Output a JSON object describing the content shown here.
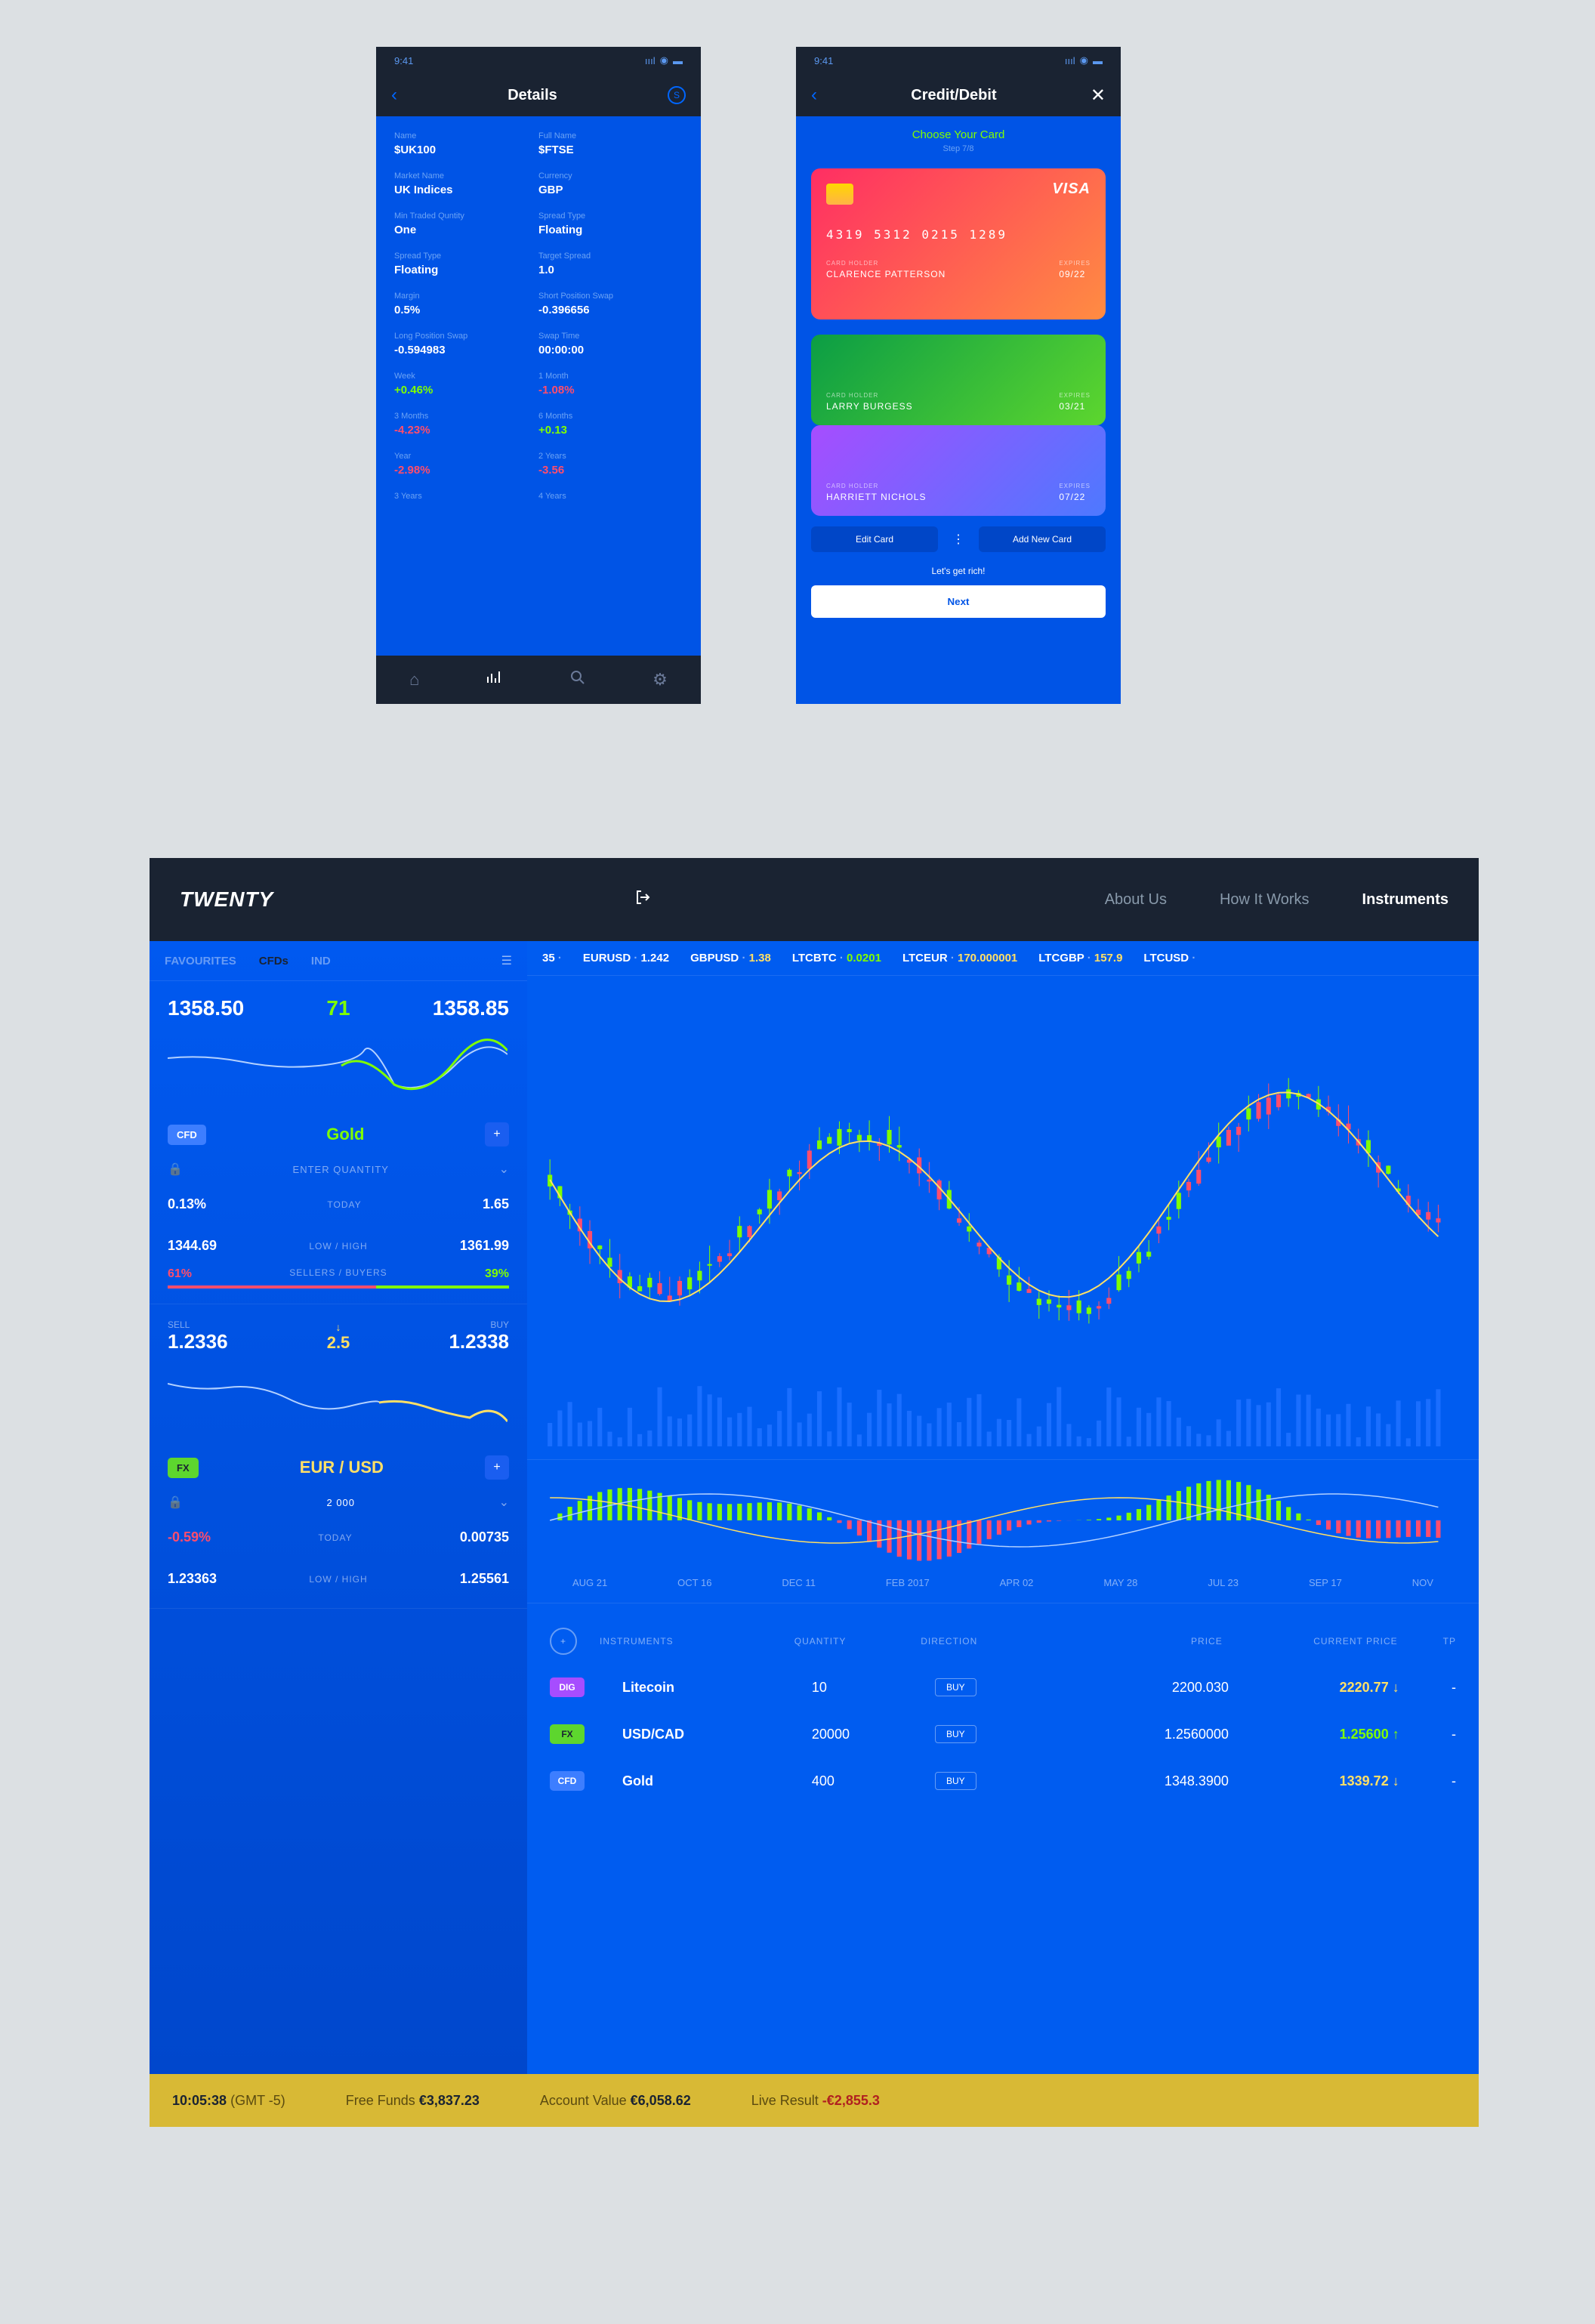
{
  "phone1": {
    "time": "9:41",
    "title": "Details",
    "fields": [
      {
        "l1": "Name",
        "v1": "$UK100",
        "l2": "Full Name",
        "v2": "$FTSE"
      },
      {
        "l1": "Market Name",
        "v1": "UK Indices",
        "l2": "Currency",
        "v2": "GBP"
      },
      {
        "l1": "Min Traded Quntity",
        "v1": "One",
        "l2": "Spread Type",
        "v2": "Floating"
      },
      {
        "l1": "Spread Type",
        "v1": "Floating",
        "l2": "Target Spread",
        "v2": "1.0"
      },
      {
        "l1": "Margin",
        "v1": "0.5%",
        "l2": "Short Position Swap",
        "v2": "-0.396656"
      },
      {
        "l1": "Long Position Swap",
        "v1": "-0.594983",
        "l2": "Swap Time",
        "v2": "00:00:00"
      }
    ],
    "perf": [
      {
        "l1": "Week",
        "v1": "+0.46%",
        "c1": "green",
        "l2": "1 Month",
        "v2": "-1.08%",
        "c2": "red"
      },
      {
        "l1": "3 Months",
        "v1": "-4.23%",
        "c1": "red",
        "l2": "6 Months",
        "v2": "+0.13",
        "c2": "green"
      },
      {
        "l1": "Year",
        "v1": "-2.98%",
        "c1": "red",
        "l2": "2 Years",
        "v2": "-3.56",
        "c2": "red"
      },
      {
        "l1": "3 Years",
        "v1": "",
        "c1": "red",
        "l2": "4 Years",
        "v2": "",
        "c2": "red"
      }
    ]
  },
  "phone2": {
    "time": "9:41",
    "title": "Credit/Debit",
    "choose": "Choose Your Card",
    "step": "Step 7/8",
    "cards": [
      {
        "brand": "VISA",
        "number": "4319   5312   0215   1289",
        "holder_label": "CARD HOLDER",
        "holder": "CLARENCE PATTERSON",
        "exp_label": "EXPIRES",
        "exp": "09/22"
      },
      {
        "holder_label": "CARD HOLDER",
        "holder": "LARRY BURGESS",
        "exp_label": "EXPIRES",
        "exp": "03/21"
      },
      {
        "holder_label": "CARD HOLDER",
        "holder": "HARRIETT NICHOLS",
        "exp_label": "EXPIRES",
        "exp": "07/22"
      }
    ],
    "edit": "Edit Card",
    "add": "Add New Card",
    "rich": "Let's get rich!",
    "next": "Next"
  },
  "app": {
    "logo": "TWENTY",
    "nav": {
      "about": "About Us",
      "how": "How It Works",
      "instruments": "Instruments"
    },
    "side_tabs": {
      "fav": "FAVOURITES",
      "cfds": "CFDs",
      "ind": "IND"
    },
    "gold": {
      "sell": "1358.50",
      "spread": "71",
      "buy": "1358.85",
      "tag": "CFD",
      "name": "Gold",
      "qty_ph": "ENTER QUANTITY",
      "change": "0.13%",
      "today": "TODAY",
      "pts": "1.65",
      "low": "1344.69",
      "lowhigh": "LOW / HIGH",
      "high": "1361.99",
      "sellers": "61%",
      "sb_label": "SELLERS / BUYERS",
      "buyers": "39%"
    },
    "eurusd": {
      "sell_label": "SELL",
      "sell": "1.2336",
      "spread": "2.5",
      "buy_label": "BUY",
      "buy": "1.2338",
      "tag": "FX",
      "name": "EUR / USD",
      "qty": "2 000",
      "change": "-0.59%",
      "today": "TODAY",
      "pts": "0.00735",
      "low": "1.23363",
      "lowhigh": "LOW / HIGH",
      "high": "1.25561"
    },
    "ticker": [
      {
        "sym": "35",
        "val": "",
        "cls": "green"
      },
      {
        "sym": "EURUSD",
        "val": "1.242",
        "cls": "white"
      },
      {
        "sym": "GBPUSD",
        "val": "1.38",
        "cls": "yellow"
      },
      {
        "sym": "LTCBTC",
        "val": "0.0201",
        "cls": "green"
      },
      {
        "sym": "LTCEUR",
        "val": "170.000001",
        "cls": "yellow"
      },
      {
        "sym": "LTCGBP",
        "val": "157.9",
        "cls": "yellow"
      },
      {
        "sym": "LTCUSD",
        "val": "",
        "cls": "white"
      }
    ],
    "dates": [
      "AUG 21",
      "OCT 16",
      "DEC 11",
      "FEB 2017",
      "APR 02",
      "MAY 28",
      "JUL 23",
      "SEP 17",
      "NOV"
    ],
    "table": {
      "headers": {
        "instr": "INSTRUMENTS",
        "qty": "QUANTITY",
        "dir": "DIRECTION",
        "price": "PRICE",
        "cprice": "CURRENT PRICE",
        "tp": "TP"
      },
      "rows": [
        {
          "tag": "DIG",
          "tagcls": "dig",
          "instr": "Litecoin",
          "qty": "10",
          "dir": "BUY",
          "price": "2200.030",
          "cprice": "2220.77 ↓",
          "ccls": "yellow",
          "tp": "-"
        },
        {
          "tag": "FX",
          "tagcls": "fx",
          "instr": "USD/CAD",
          "qty": "20000",
          "dir": "BUY",
          "price": "1.2560000",
          "cprice": "1.25600 ↑",
          "ccls": "green",
          "tp": "-"
        },
        {
          "tag": "CFD",
          "tagcls": "cfd",
          "instr": "Gold",
          "qty": "400",
          "dir": "BUY",
          "price": "1348.3900",
          "cprice": "1339.72 ↓",
          "ccls": "yellow",
          "tp": "-"
        }
      ]
    },
    "status": {
      "time": "10:05:38",
      "tz": "(GMT -5)",
      "ff_label": "Free Funds",
      "ff": "€3,837.23",
      "av_label": "Account Value",
      "av": "€6,058.62",
      "lr_label": "Live Result",
      "lr": "-€2,855.3"
    }
  },
  "chart_data": {
    "type": "candlestick",
    "title": "Price Chart",
    "x_categories": [
      "AUG 21",
      "OCT 16",
      "DEC 11",
      "FEB 2017",
      "APR 02",
      "MAY 28",
      "JUL 23",
      "SEP 17",
      "NOV"
    ],
    "note": "Candlestick OHLC financial chart with moving average overlay, volume bars below, and MACD oscillator panel. Values not labeled on axes — decorative financial visualization.",
    "candles_approx_count": 90,
    "overlays": [
      "moving_average_line_yellow"
    ],
    "sub_panels": [
      "volume_bars",
      "macd_histogram_with_two_lines"
    ]
  }
}
